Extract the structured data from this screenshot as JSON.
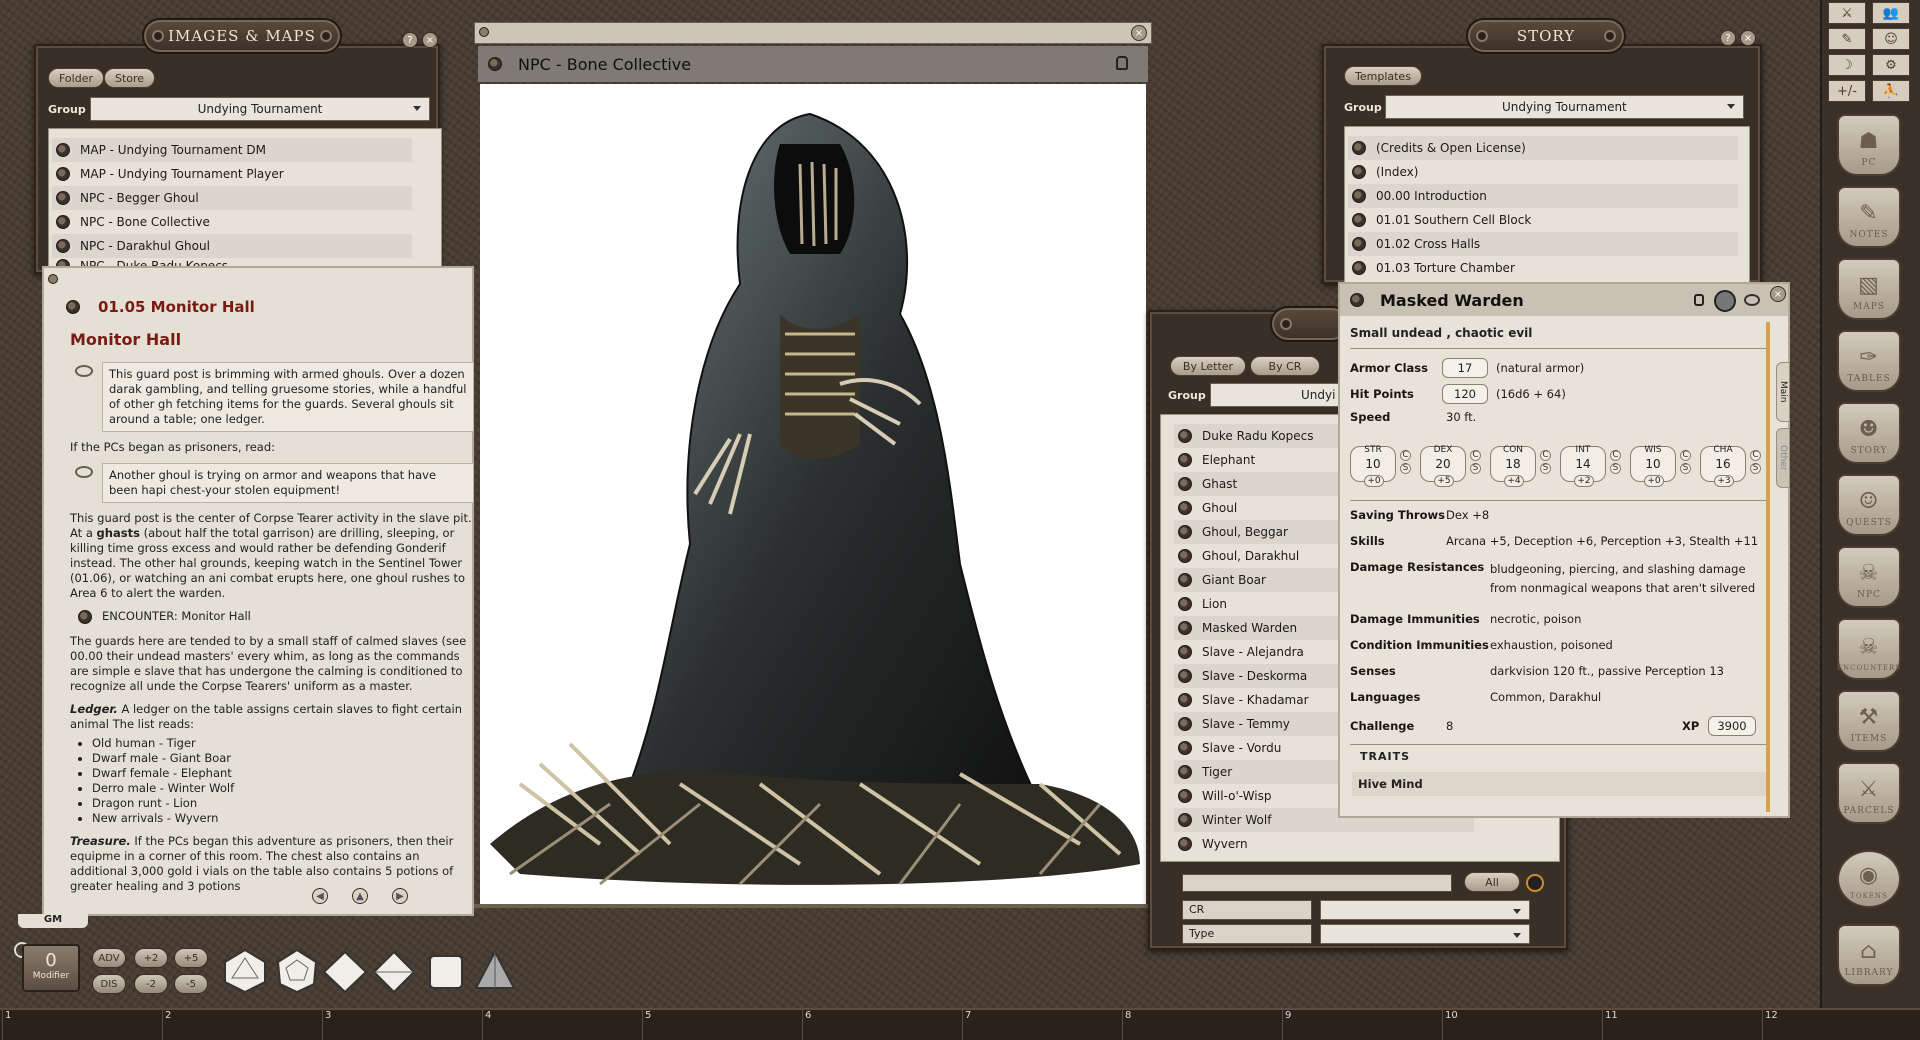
{
  "images_maps": {
    "title": "IMAGES & MAPS",
    "folder_btn": "Folder",
    "store_btn": "Store",
    "group_label": "Group",
    "group_value": "Undying Tournament",
    "items": [
      "MAP - Undying Tournament DM",
      "MAP - Undying Tournament Player",
      "NPC - Begger Ghoul",
      "NPC - Bone Collective",
      "NPC - Darakhul Ghoul",
      "NPC - Duke Radu Kopecs"
    ]
  },
  "story_entry": {
    "title": "01.05 Monitor Hall",
    "heading": "Monitor Hall",
    "quote1": "This guard post is brimming with armed ghouls. Over a dozen darak gambling, and telling gruesome stories, while a handful of other gh fetching items for the guards. Several ghouls sit around a table; one ledger.",
    "prisoners_line": "If the PCs began as prisoners, read:",
    "quote2": "Another ghoul is trying on armor and weapons that have been hapi chest-your stolen equipment!",
    "para1_a": "This guard post is the center of Corpse Tearer activity in the slave pit. At a",
    "para1_b": "ghasts",
    "para1_c": " (about half the total garrison) are drilling, sleeping, or killing time gross excess and would rather be defending Gonderif instead. The other hal grounds, keeping watch in the Sentinel Tower (01.06), or watching an ani combat erupts here, one ghoul rushes to Area 6 to alert the warden.",
    "encounter": "ENCOUNTER: Monitor Hall",
    "para2": "The guards here are tended to by a small staff of calmed slaves (see 00.00 their undead masters' every whim, as long as the commands are simple e slave that has undergone the calming is conditioned to recognize all unde the Corpse Tearers' uniform as a master.",
    "ledger_label": "Ledger.",
    "ledger_text": " A ledger on the table assigns certain slaves to fight certain animal The list reads:",
    "ledger_list": [
      "Old human - Tiger",
      "Dwarf male - Giant Boar",
      "Dwarf female - Elephant",
      "Derro male - Winter Wolf",
      "Dragon runt - Lion",
      "New arrivals - Wyvern"
    ],
    "treasure_label": "Treasure.",
    "treasure_text": " If the PCs began this adventure as prisoners, then their equipme in a corner of this room. The chest also contains an additional 3,000 gold i vials on the table also contains 5 potions of greater healing and 3 potions"
  },
  "npc_image": {
    "title": "NPC - Bone Collective"
  },
  "story": {
    "title": "STORY",
    "templates_btn": "Templates",
    "group_label": "Group",
    "group_value": "Undying Tournament",
    "items": [
      "(Credits & Open License)",
      "(Index)",
      "00.00 Introduction",
      "01.01 Southern Cell Block",
      "01.02 Cross Halls",
      "01.03 Torture Chamber"
    ]
  },
  "npc_list": {
    "by_letter": "By Letter",
    "by_cr": "By CR",
    "group_label": "Group",
    "group_value": "Undyi",
    "items": [
      "Duke Radu Kopecs",
      "Elephant",
      "Ghast",
      "Ghoul",
      "Ghoul, Beggar",
      "Ghoul, Darakhul",
      "Giant Boar",
      "Lion",
      "Masked Warden",
      "Slave - Alejandra",
      "Slave - Deskorma",
      "Slave - Khadamar",
      "Slave - Temmy",
      "Slave - Vordu",
      "Tiger",
      "Will-o'-Wisp",
      "Winter Wolf",
      "Wyvern"
    ],
    "all_btn": "All",
    "filter_cr": "CR",
    "filter_type": "Type"
  },
  "statblock": {
    "name": "Masked Warden",
    "type_line": "Small undead , chaotic evil",
    "armor_class_label": "Armor Class",
    "armor_class": "17",
    "armor_note": "(natural armor)",
    "hit_points_label": "Hit Points",
    "hit_points": "120",
    "hp_formula": "(16d6 + 64)",
    "speed_label": "Speed",
    "speed": "30 ft.",
    "abilities": [
      {
        "name": "STR",
        "score": "10",
        "mod": "+0"
      },
      {
        "name": "DEX",
        "score": "20",
        "mod": "+5"
      },
      {
        "name": "CON",
        "score": "18",
        "mod": "+4"
      },
      {
        "name": "INT",
        "score": "14",
        "mod": "+2"
      },
      {
        "name": "WIS",
        "score": "10",
        "mod": "+0"
      },
      {
        "name": "CHA",
        "score": "16",
        "mod": "+3"
      }
    ],
    "ab_c": "C",
    "ab_s": "S",
    "saving_throws_label": "Saving Throws",
    "saving_throws": "Dex +8",
    "skills_label": "Skills",
    "skills": "Arcana +5, Deception +6, Perception +3, Stealth +11",
    "dmg_res_label": "Damage Resistances",
    "dmg_res": "bludgeoning, piercing, and slashing damage from nonmagical weapons that aren't silvered",
    "dmg_imm_label": "Damage Immunities",
    "dmg_imm": "necrotic, poison",
    "cond_imm_label": "Condition Immunities",
    "cond_imm": "exhaustion, poisoned",
    "senses_label": "Senses",
    "senses": "darkvision 120 ft., passive Perception 13",
    "languages_label": "Languages",
    "languages": "Common, Darakhul",
    "challenge_label": "Challenge",
    "challenge": "8",
    "xp_label": "XP",
    "xp": "3900",
    "traits_header": "TRAITS",
    "trait1": "Hive Mind",
    "tab_main": "Main",
    "tab_other": "Other"
  },
  "sidebar": {
    "buttons": [
      "PC",
      "NOTES",
      "MAPS",
      "TABLES",
      "STORY",
      "QUESTS",
      "NPC",
      "ENCOUNTERS",
      "ITEMS",
      "PARCELS",
      "TOKENS",
      "LIBRARY"
    ],
    "top_tools": [
      "⚔",
      "👥",
      "✎",
      "☺",
      "☽",
      "⚙",
      "+/-",
      "⛹"
    ]
  },
  "bottom": {
    "gm_label": "GM",
    "modifier_value": "0",
    "modifier_label": "Modifier",
    "adv": "ADV",
    "dis": "DIS",
    "plus2": "+2",
    "plus5": "+5",
    "minus2": "-2",
    "minus5": "-5",
    "dice": [
      "d20",
      "d12",
      "d10",
      "d8",
      "d6",
      "d4"
    ],
    "hotkeys": [
      "1",
      "2",
      "3",
      "4",
      "5",
      "6",
      "7",
      "8",
      "9",
      "10",
      "11",
      "12"
    ]
  },
  "colors": {
    "accent_red": "#7a1b12",
    "leather": "#463a30",
    "paper": "#e7e2d8"
  }
}
